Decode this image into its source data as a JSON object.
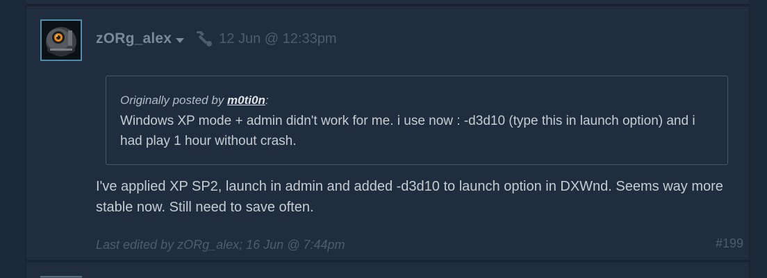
{
  "post": {
    "author": "zORg_alex",
    "timestamp": "12 Jun @ 12:33pm",
    "quote": {
      "prefix": "Originally posted by ",
      "author": "m0ti0n",
      "suffix": ":",
      "text": "Windows XP mode + admin didn't work for me. i use now : -d3d10 (type this in launch option) and i had play 1 hour without crash."
    },
    "body": "I've applied XP SP2, launch in admin and added -d3d10 to launch option in DXWnd. Seems way more stable now. Still need to save often.",
    "edited": {
      "prefix": "Last edited by ",
      "author": "zORg_alex",
      "suffix": "; 16 Jun @ 7:44pm"
    },
    "post_number": "#199"
  },
  "icons": {
    "author_menu": "chevron-down-icon",
    "edit_tool": "hammer-icon"
  },
  "colors": {
    "background": "#1b2838",
    "post_background": "#1f2d3f",
    "avatar_border": "#4b8fa8",
    "muted_text": "#4f5d6a",
    "body_text": "#c6ccd2"
  }
}
